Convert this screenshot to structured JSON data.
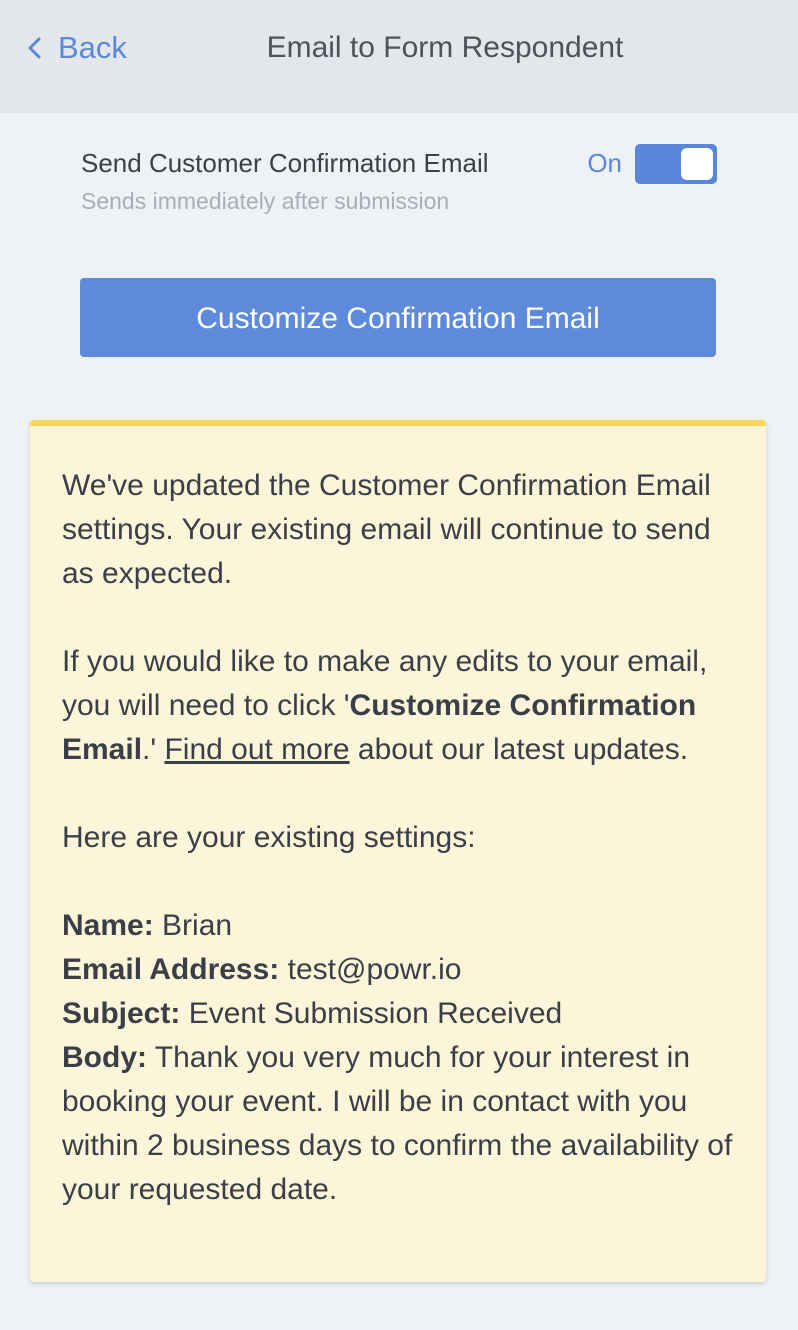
{
  "header": {
    "back_label": "Back",
    "title": "Email to Form Respondent"
  },
  "setting": {
    "label": "Send Customer Confirmation Email",
    "sublabel": "Sends immediately after submission",
    "toggle_state": "On",
    "toggle_on": true
  },
  "customize_button": {
    "label": "Customize Confirmation Email"
  },
  "notice": {
    "paragraph1": "We've updated the Customer Confirmation Email settings. Your existing email will continue to send as expected.",
    "paragraph2": {
      "text_before": "If you would like to make any edits to your email, you will need to click '",
      "bold": "Customize Confirmation Email",
      "text_middle": ".' ",
      "link": "Find out more",
      "text_after": " about our latest updates."
    },
    "paragraph3": "Here are your existing settings:",
    "settings": [
      {
        "key": "Name:",
        "value": " Brian"
      },
      {
        "key": "Email Address:",
        "value": " test@powr.io"
      },
      {
        "key": "Subject:",
        "value": " Event Submission Received"
      },
      {
        "key": "Body:",
        "value": " Thank you very much for your interest in booking your event. I will be in contact with you within 2 business days to confirm the availability of your requested date."
      }
    ]
  },
  "colors": {
    "accent": "#5b87db",
    "notice_bg": "#fdf5d9",
    "notice_border": "#f9d660",
    "header_bg": "#e3e7eb",
    "page_bg": "#eef2f6"
  },
  "icons": {
    "back": "chevron-left-icon"
  }
}
